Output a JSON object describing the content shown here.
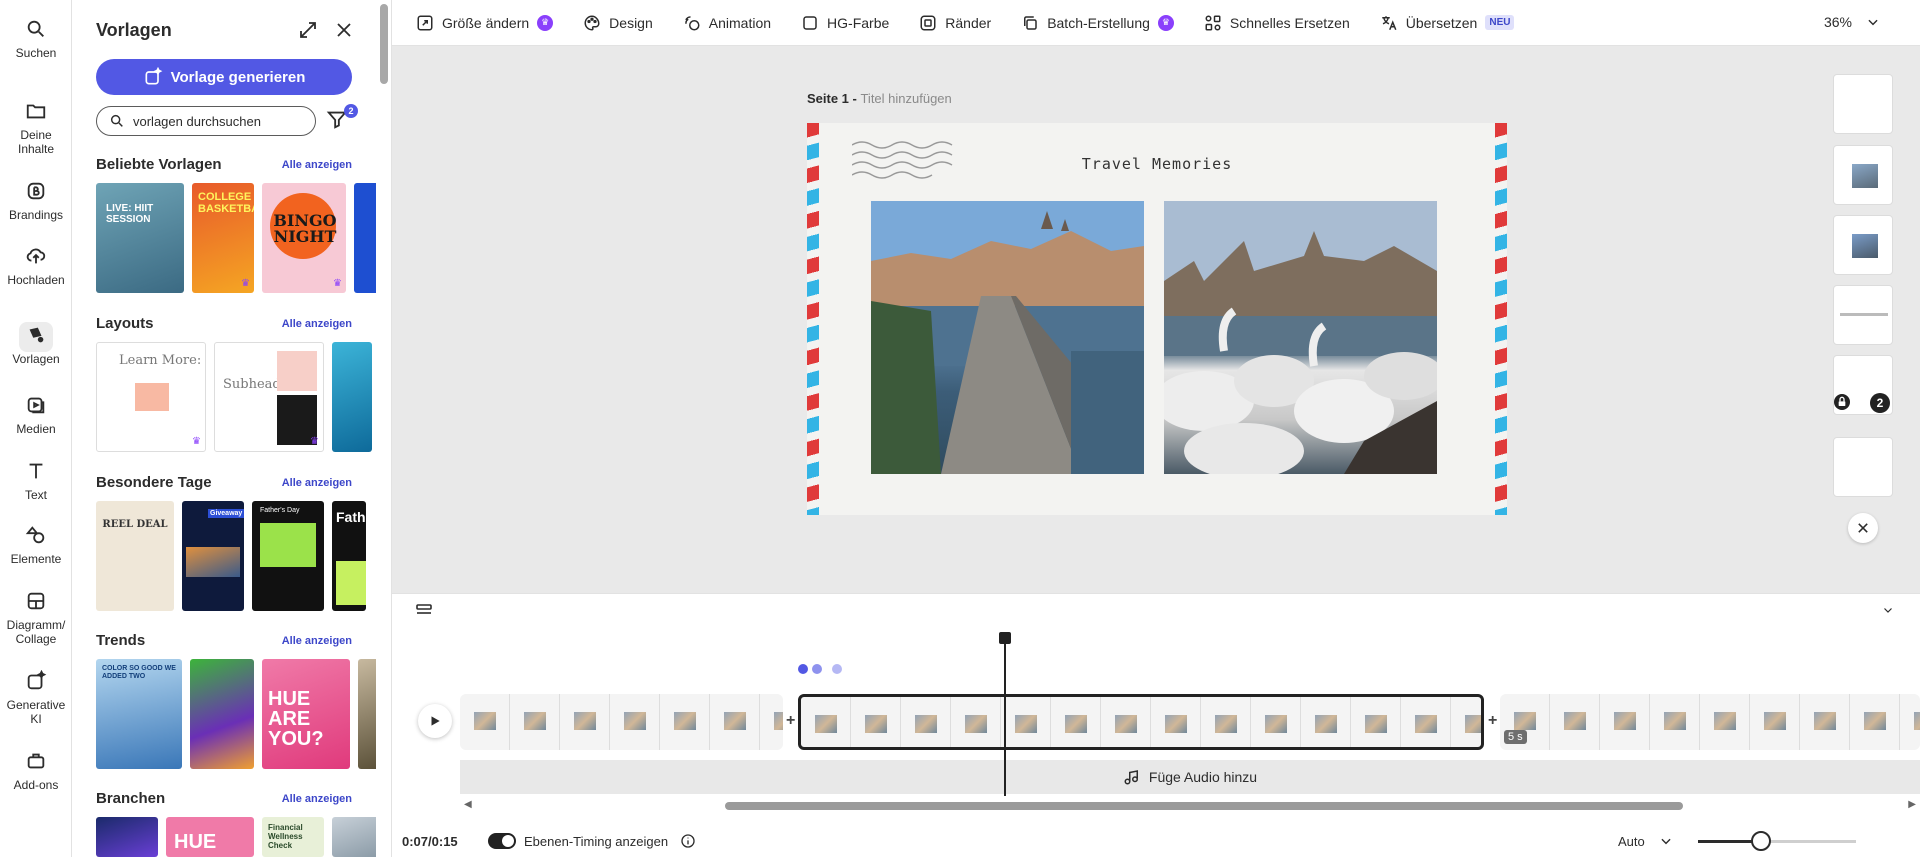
{
  "rail": {
    "items": [
      {
        "label": "Suchen",
        "icon": "search-icon"
      },
      {
        "label": "Deine Inhalte",
        "icon": "folder-icon"
      },
      {
        "label": "Brandings",
        "icon": "brand-icon"
      },
      {
        "label": "Hochladen",
        "icon": "upload-icon"
      },
      {
        "label": "Vorlagen",
        "icon": "templates-icon"
      },
      {
        "label": "Medien",
        "icon": "media-icon"
      },
      {
        "label": "Text",
        "icon": "text-icon"
      },
      {
        "label": "Elemente",
        "icon": "elements-icon"
      },
      {
        "label": "Diagramm/ Collage",
        "icon": "grid-icon"
      },
      {
        "label": "Generative KI",
        "icon": "ai-icon"
      },
      {
        "label": "Add-ons",
        "icon": "addons-icon"
      }
    ]
  },
  "panel": {
    "title": "Vorlagen",
    "generate_label": "Vorlage generieren",
    "search_value": "vorlagen durchsuchen",
    "filter_count": "2",
    "see_all": "Alle anzeigen",
    "sections": [
      {
        "title": "Beliebte Vorlagen",
        "cards": [
          "LIVE: HIIT SESSION",
          "COLLEGE BASKETBALL",
          "BINGO NIGHT"
        ]
      },
      {
        "title": "Layouts",
        "cards": [
          "Learn More:",
          "Subhead"
        ]
      },
      {
        "title": "Besondere Tage",
        "cards": [
          "REEL DEAL",
          "Giveaway",
          "Father's Day",
          "Fath"
        ]
      },
      {
        "title": "Trends",
        "cards": [
          "COLOR SO GOOD WE ADDED TWO",
          "HUE ARE YOU?"
        ]
      },
      {
        "title": "Branchen",
        "cards": [
          "HUE",
          "Financial Wellness Check"
        ]
      }
    ]
  },
  "toolbar": {
    "items": [
      {
        "label": "Größe ändern",
        "icon": "resize-icon",
        "premium": true
      },
      {
        "label": "Design",
        "icon": "palette-icon"
      },
      {
        "label": "Animation",
        "icon": "animation-icon"
      },
      {
        "label": "HG-Farbe",
        "icon": "checkbox-icon"
      },
      {
        "label": "Ränder",
        "icon": "border-icon"
      },
      {
        "label": "Batch-Erstellung",
        "icon": "batch-icon",
        "premium": true
      },
      {
        "label": "Schnelles Ersetzen",
        "icon": "replace-icon"
      },
      {
        "label": "Übersetzen",
        "icon": "translate-icon",
        "badge": "NEU"
      }
    ],
    "zoom": "36%"
  },
  "canvas": {
    "page_label": "Seite 1 - ",
    "page_title_placeholder": "Titel hinzufügen",
    "card_title": "Travel Memories",
    "page_count_badge": "2"
  },
  "timeline": {
    "clip_duration": "5 s",
    "add_audio": "Füge Audio hinzu",
    "time": "0:07/0:15",
    "layer_timing_label": "Ebenen-Timing anzeigen",
    "auto_label": "Auto",
    "slider_value": 0.4
  },
  "colors": {
    "accent": "#5258e4",
    "premium": "#8a3ffc",
    "stripe_red": "#e03a3a",
    "stripe_blue": "#33b4e5"
  }
}
